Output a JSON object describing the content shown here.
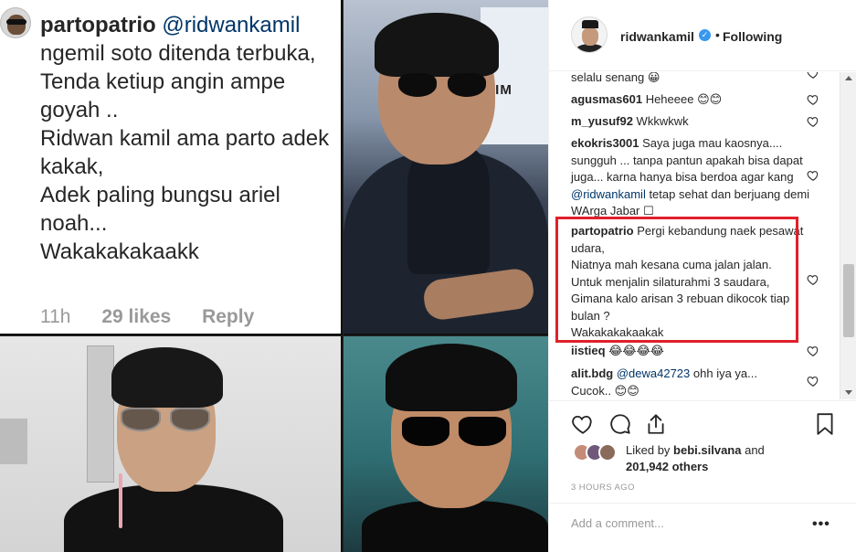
{
  "screenshot_comment": {
    "username": "partopatrio",
    "mention": "@ridwankamil",
    "text": "ngemil soto ditenda terbuka,\nTenda ketiup angin ampe goyah ..\nRidwan kamil ama parto adek kakak,\nAdek paling bungsu ariel noah...\nWakakakakaakk",
    "time": "11h",
    "likes": "29 likes",
    "reply": "Reply"
  },
  "background_sign_text": "TIM",
  "post": {
    "author": "ridwankamil",
    "verified_icon": "verified-badge-icon",
    "follow_status": "Following",
    "dot": "•",
    "comments": [
      {
        "user": "",
        "text": "selalu senang 😀",
        "heart": true
      },
      {
        "user": "agusmas601",
        "text": "Heheeee 😊😊",
        "heart": true
      },
      {
        "user": "m_yusuf92",
        "text": "Wkkwkwk",
        "heart": true
      },
      {
        "user": "ekokris3001",
        "text": "Saya juga mau kaosnya.... sungguh ... tanpa pantun apakah bisa dapat juga... karna hanya bisa berdoa agar kang ",
        "mention": "@ridwankamil",
        "text_after": " tetap sehat dan berjuang demi WArga Jabar ☐",
        "heart": true
      },
      {
        "user": "partopatrio",
        "text": "Pergi kebandung naek pesawat udara,\nNiatnya mah kesana cuma jalan jalan.\nUntuk menjalin silaturahmi 3 saudara,\nGimana kalo arisan 3 rebuan dikocok tiap bulan ?\nWakakakakaakak",
        "heart": true
      },
      {
        "user": "iistieq",
        "text": "😂😂😂😂",
        "heart": true
      },
      {
        "user": "alit.bdg",
        "mention": "@dewa42723",
        "text_after": " ohh iya ya...\nCucok.. 😊😊",
        "heart": true
      }
    ],
    "actions": [
      "heart-icon",
      "comment-icon",
      "share-icon",
      "bookmark-icon"
    ],
    "likes": {
      "prefix": "Liked by",
      "user": "bebi.silvana",
      "conj": "and",
      "count": "201,942 others"
    },
    "timestamp": "3 HOURS AGO",
    "add_comment_placeholder": "Add a comment...",
    "more": "•••"
  },
  "colors": {
    "highlight": "#e0202a",
    "mention": "#003569",
    "verified": "#3897f0",
    "muted": "#999999"
  }
}
